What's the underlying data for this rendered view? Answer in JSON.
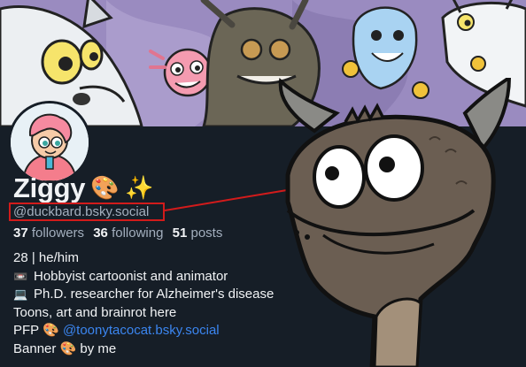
{
  "profile": {
    "display_name": "Ziggy",
    "name_emojis": "🎨 ✨",
    "handle": "@duckbard.bsky.social",
    "stats": {
      "followers_count": "37",
      "followers_label": "followers",
      "following_count": "36",
      "following_label": "following",
      "posts_count": "51",
      "posts_label": "posts"
    },
    "bio": {
      "line1": "28 | he/him",
      "line2_icon": "📼",
      "line2": "Hobbyist cartoonist and animator",
      "line3_icon": "💻",
      "line3": "Ph.D. researcher for Alzheimer's disease",
      "line4": "Toons, art and brainrot here",
      "line5_prefix": "PFP",
      "line5_icon": "🎨",
      "line5_link": "@toonytacocat.bsky.social",
      "line6_prefix": "Banner",
      "line6_icon": "🎨",
      "line6_suffix": "by me"
    }
  },
  "colors": {
    "background": "#161e27",
    "text": "#f1f3f5",
    "muted": "#a3afbe",
    "link": "#3b86f0",
    "highlight": "#d21b1b"
  },
  "icons": {
    "banner": "cartoon-characters-banner",
    "avatar": "cartoon-character-avatar",
    "overlay": "cartoon-creature-sticker"
  }
}
